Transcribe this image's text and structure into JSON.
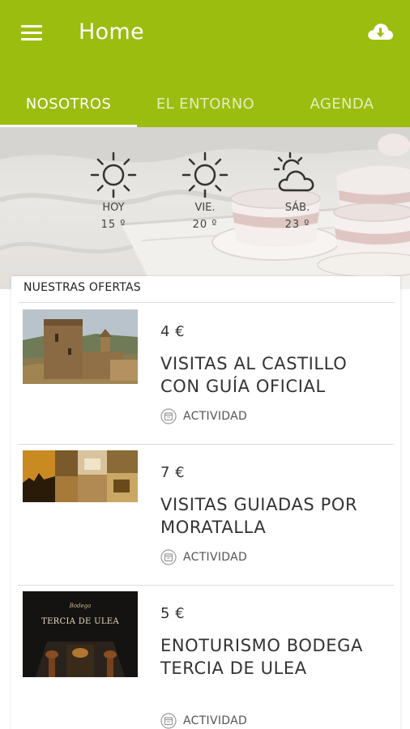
{
  "header": {
    "title": "Home",
    "accent_color": "#9bbd0f",
    "menu_icon": "hamburger-menu-icon",
    "download_icon": "cloud-download-icon"
  },
  "tabs": [
    {
      "label": "NOSOTROS",
      "active": true
    },
    {
      "label": "EL ENTORNO",
      "active": false
    },
    {
      "label": "AGENDA",
      "active": false
    }
  ],
  "weather": [
    {
      "day": "HOY",
      "temp": "15 º",
      "icon": "sun-icon"
    },
    {
      "day": "VIE.",
      "temp": "20 º",
      "icon": "sun-icon"
    },
    {
      "day": "SÁB.",
      "temp": "23 º",
      "icon": "partly-cloudy-icon"
    }
  ],
  "offers_section": {
    "title": "NUESTRAS OFERTAS",
    "items": [
      {
        "price": "4 €",
        "title": "VISITAS AL CASTILLO CON GUÍA OFICIAL",
        "category": "ACTIVIDAD",
        "image": "castle-photo"
      },
      {
        "price": "7 €",
        "title": "VISITAS GUIADAS POR MORATALLA",
        "category": "ACTIVIDAD",
        "image": "moratalla-collage-photo"
      },
      {
        "price": "5 €",
        "title": "ENOTURISMO BODEGA TERCIA DE ULEA",
        "category": "ACTIVIDAD",
        "image": "bodega-photo",
        "image_text_1": "Bodega",
        "image_text_2": "TERCIA DE ULEA"
      }
    ]
  }
}
